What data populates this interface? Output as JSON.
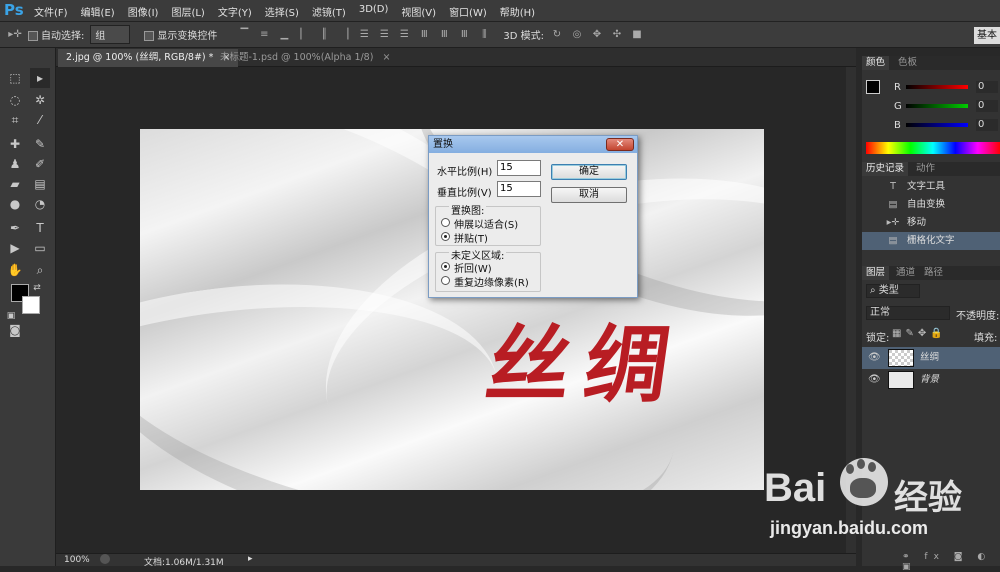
{
  "app": {
    "logo": "Ps"
  },
  "menu": [
    "文件(F)",
    "编辑(E)",
    "图像(I)",
    "图层(L)",
    "文字(Y)",
    "选择(S)",
    "滤镜(T)",
    "3D(D)",
    "视图(V)",
    "窗口(W)",
    "帮助(H)"
  ],
  "options_bar": {
    "auto_select_label": "自动选择:",
    "auto_select_value": "组",
    "show_transform_label": "显示变换控件",
    "mode_3d_label": "3D 模式:",
    "workspace_button": "基本"
  },
  "tabs": [
    {
      "label": "2.jpg @ 100% (丝绸, RGB/8#) *",
      "active": true
    },
    {
      "label": "未标题-1.psd @ 100%(Alpha 1/8)",
      "active": false
    }
  ],
  "canvas": {
    "text": "丝绸"
  },
  "status": {
    "zoom": "100%",
    "doc": "文档:1.06M/1.31M"
  },
  "color_panel": {
    "tabs": [
      "颜色",
      "色板"
    ],
    "channels": [
      {
        "label": "R",
        "value": "0"
      },
      {
        "label": "G",
        "value": "0"
      },
      {
        "label": "B",
        "value": "0"
      }
    ]
  },
  "history_panel": {
    "tabs": [
      "历史记录",
      "动作"
    ],
    "items": [
      {
        "label": "文字工具",
        "icon": "type-icon"
      },
      {
        "label": "自由变换",
        "icon": "transform-icon"
      },
      {
        "label": "移动",
        "icon": "move-icon"
      },
      {
        "label": "栅格化文字",
        "icon": "rasterize-icon",
        "selected": true
      }
    ]
  },
  "layers_panel": {
    "tabs": [
      "图层",
      "通道",
      "路径"
    ],
    "filter": "类型",
    "blend_mode": "正常",
    "opacity_label": "不透明度:",
    "lock_label": "锁定:",
    "fill_label": "填充:",
    "layers": [
      {
        "name": "丝绸",
        "selected": true
      },
      {
        "name": "背景",
        "selected": false
      }
    ]
  },
  "dialog": {
    "title": "置换",
    "close": "✕",
    "h_scale_label": "水平比例(H)",
    "h_scale_value": "15",
    "v_scale_label": "垂直比例(V)",
    "v_scale_value": "15",
    "ok": "确定",
    "cancel": "取消",
    "map_group_label": "置换图:",
    "map_options": [
      {
        "label": "伸展以适合(S)",
        "checked": false
      },
      {
        "label": "拼贴(T)",
        "checked": true
      }
    ],
    "undef_group_label": "未定义区域:",
    "undef_options": [
      {
        "label": "折回(W)",
        "checked": true
      },
      {
        "label": "重复边缘像素(R)",
        "checked": false
      }
    ]
  },
  "watermark": {
    "brand": "Bai",
    "brand2": "经验",
    "url": "jingyan.baidu.com"
  }
}
